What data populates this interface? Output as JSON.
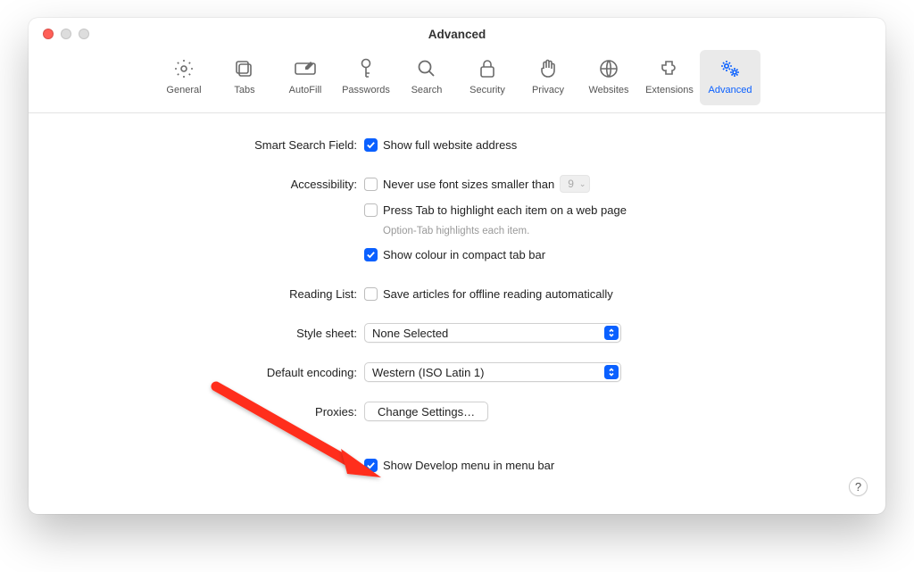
{
  "window": {
    "title": "Advanced"
  },
  "toolbar": {
    "items": [
      {
        "label": "General"
      },
      {
        "label": "Tabs"
      },
      {
        "label": "AutoFill"
      },
      {
        "label": "Passwords"
      },
      {
        "label": "Search"
      },
      {
        "label": "Security"
      },
      {
        "label": "Privacy"
      },
      {
        "label": "Websites"
      },
      {
        "label": "Extensions"
      },
      {
        "label": "Advanced"
      }
    ]
  },
  "sections": {
    "smartSearch": {
      "label": "Smart Search Field:",
      "fullUrl": {
        "checked": true,
        "text": "Show full website address"
      }
    },
    "accessibility": {
      "label": "Accessibility:",
      "minFont": {
        "checked": false,
        "text": "Never use font sizes smaller than",
        "value": "9"
      },
      "pressTab": {
        "checked": false,
        "text": "Press Tab to highlight each item on a web page"
      },
      "hint": "Option-Tab highlights each item.",
      "compactColor": {
        "checked": true,
        "text": "Show colour in compact tab bar"
      }
    },
    "readingList": {
      "label": "Reading List:",
      "offline": {
        "checked": false,
        "text": "Save articles for offline reading automatically"
      }
    },
    "styleSheet": {
      "label": "Style sheet:",
      "value": "None Selected"
    },
    "encoding": {
      "label": "Default encoding:",
      "value": "Western (ISO Latin 1)"
    },
    "proxies": {
      "label": "Proxies:",
      "button": "Change Settings…"
    },
    "develop": {
      "checked": true,
      "text": "Show Develop menu in menu bar"
    }
  },
  "help": {
    "label": "?"
  }
}
